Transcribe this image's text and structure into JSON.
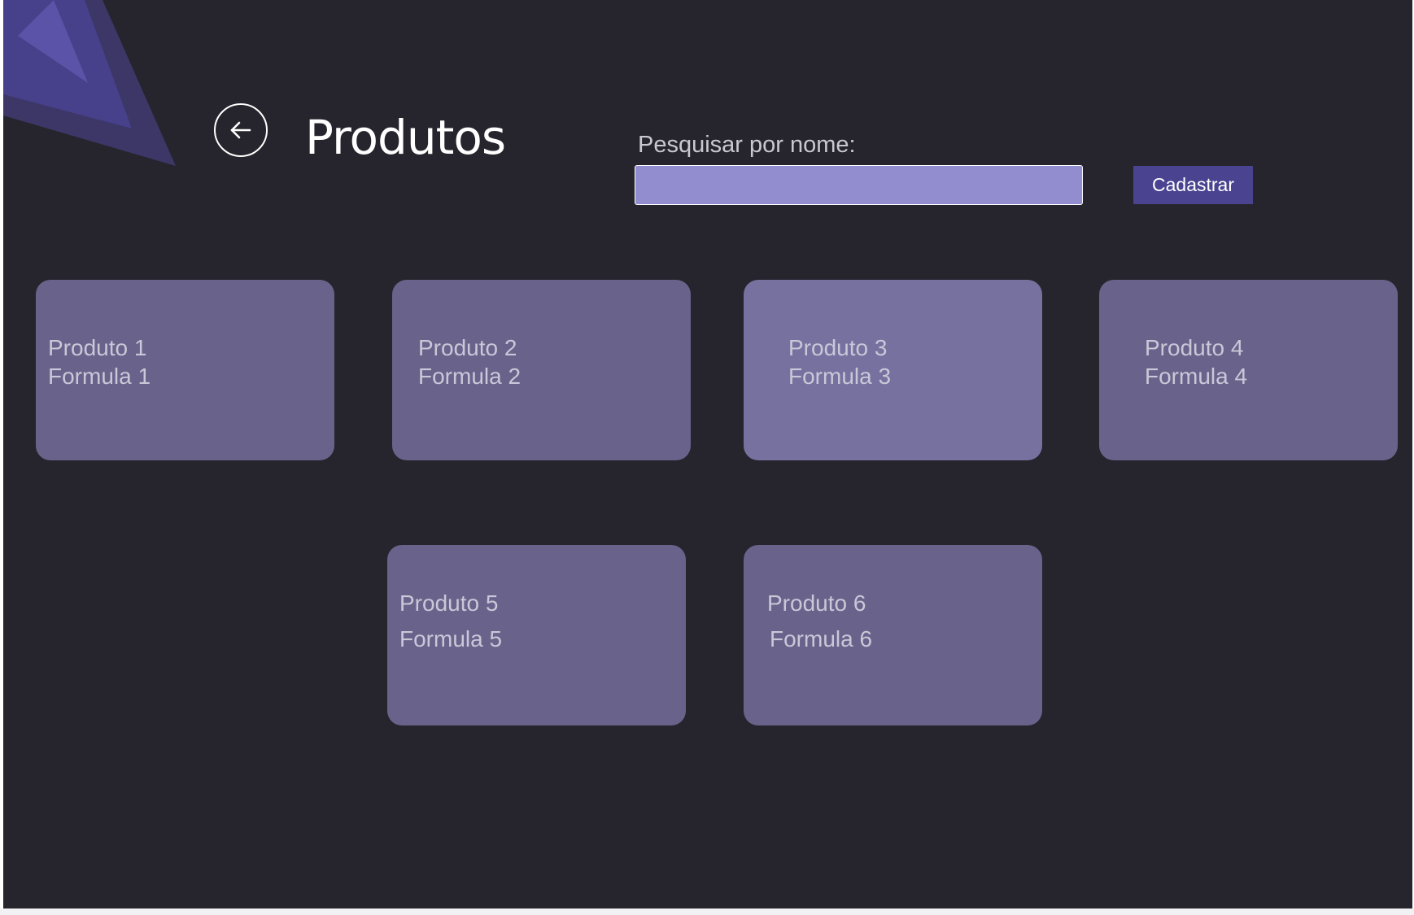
{
  "page": {
    "title": "Produtos",
    "back_icon": "arrow-left-icon"
  },
  "search": {
    "label": "Pesquisar por nome:",
    "value": "",
    "placeholder": ""
  },
  "actions": {
    "register_label": "Cadastrar"
  },
  "products": [
    {
      "name": "Produto 1",
      "formula": "Formula 1"
    },
    {
      "name": "Produto 2",
      "formula": "Formula 2"
    },
    {
      "name": "Produto 3",
      "formula": "Formula 3"
    },
    {
      "name": "Produto 4",
      "formula": "Formula 4"
    },
    {
      "name": "Produto 5",
      "formula": "Formula 5"
    },
    {
      "name": "Produto 6",
      "formula": "Formula 6"
    }
  ],
  "colors": {
    "background": "#26252d",
    "accent": "#4a4390",
    "input_fill": "#918dcf",
    "card_fill": "#69638b",
    "card_fill_highlight": "#77719f"
  }
}
